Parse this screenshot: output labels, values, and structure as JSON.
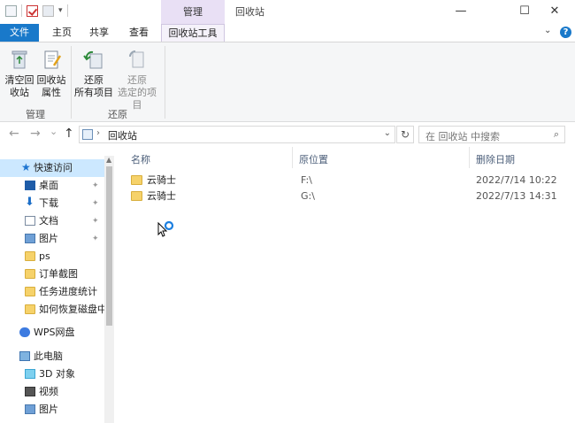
{
  "titlebar": {
    "context_tab": "管理",
    "window_title": "回收站",
    "minimize": "—",
    "maximize": "☐",
    "close": "✕"
  },
  "tabs": {
    "file": "文件",
    "home": "主页",
    "share": "共享",
    "view": "查看",
    "recycle_tools": "回收站工具"
  },
  "ribbon": {
    "empty_bin": [
      "清空回",
      "收站"
    ],
    "bin_props": [
      "回收站",
      "属性"
    ],
    "restore_all": [
      "还原",
      "所有项目"
    ],
    "restore_selected": [
      "还原",
      "选定的项目"
    ],
    "group_manage": "管理",
    "group_restore": "还原"
  },
  "nav": {
    "back": "←",
    "forward": "→",
    "recent": "⌄",
    "up": "↑",
    "current": "回收站",
    "chevron": "›",
    "dropdown": "⌄",
    "refresh": "↻",
    "search_placeholder": "在 回收站 中搜索",
    "search_icon": "⌕"
  },
  "sidebar": {
    "items": [
      {
        "label": "快速访问",
        "icon": "star-icon"
      },
      {
        "label": "桌面",
        "icon": "desktop-folder-icon",
        "pinned": true
      },
      {
        "label": "下载",
        "icon": "download-icon",
        "pinned": true
      },
      {
        "label": "文档",
        "icon": "documents-icon",
        "pinned": true
      },
      {
        "label": "图片",
        "icon": "pictures-icon",
        "pinned": true
      },
      {
        "label": "ps",
        "icon": "folder-icon"
      },
      {
        "label": "订单截图",
        "icon": "folder-icon"
      },
      {
        "label": "任务进度统计",
        "icon": "folder-icon"
      },
      {
        "label": "如何恢复磁盘中",
        "icon": "folder-icon"
      },
      {
        "label": "WPS网盘",
        "icon": "cloud-icon"
      },
      {
        "label": "此电脑",
        "icon": "computer-icon"
      },
      {
        "label": "3D 对象",
        "icon": "3d-objects-icon"
      },
      {
        "label": "视频",
        "icon": "video-icon"
      },
      {
        "label": "图片",
        "icon": "pictures-icon"
      }
    ],
    "pin_glyph": "📌"
  },
  "columns": {
    "name": "名称",
    "location": "原位置",
    "deleted": "删除日期"
  },
  "files": [
    {
      "name": "云骑士",
      "location": "F:\\",
      "deleted": "2022/7/14 10:22"
    },
    {
      "name": "云骑士",
      "location": "G:\\",
      "deleted": "2022/7/13 14:31"
    }
  ],
  "colors": {
    "file_tab": "#1979ca",
    "context_tab": "#e9e0f5",
    "selection": "#cce8ff"
  }
}
